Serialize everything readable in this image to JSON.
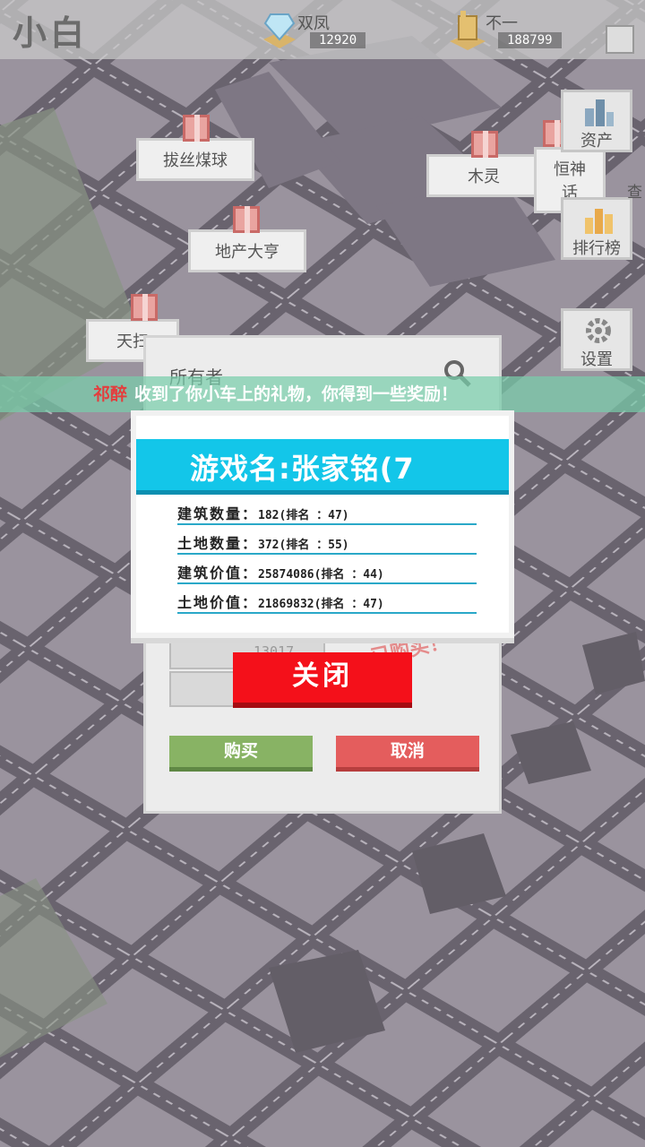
{
  "player": {
    "name": "小白"
  },
  "resources": {
    "gem": {
      "name": "双凤",
      "value": "12920",
      "icon": "diamond-icon"
    },
    "coin": {
      "name": "不一",
      "value": "188799",
      "icon": "coin-stack-icon"
    }
  },
  "map_bubbles": [
    {
      "label": "拔丝煤球"
    },
    {
      "label": "木灵"
    },
    {
      "label": "恒神话"
    },
    {
      "label": "地产大亨"
    },
    {
      "label": "天扫"
    }
  ],
  "side_menu": {
    "assets": "资产",
    "ranking": "排行榜",
    "settings": "设置",
    "peek": "查"
  },
  "owner_dialog": {
    "title": "所有者",
    "coin_value": "13017",
    "buy_label": "购买",
    "cancel_label": "取消",
    "stamp_text": "已购买！"
  },
  "notice": {
    "player": "祁醉",
    "message": "收到了你小车上的礼物，你得到一些奖励！"
  },
  "info_card": {
    "title": "游戏名:张家铭(7",
    "rows": [
      {
        "label": "建筑数量：",
        "value": "182(排名 ：47)"
      },
      {
        "label": "土地数量：",
        "value": "372(排名 ：55)"
      },
      {
        "label": "建筑价值：",
        "value": "25874086(排名 ：44)"
      },
      {
        "label": "土地价值：",
        "value": "21869832(排名 ：47)"
      }
    ],
    "close_label": "关闭"
  },
  "colors": {
    "accent": "#13c6e9",
    "close": "#f4101a",
    "buy": "#88b364",
    "cancel": "#e45d5d",
    "notice_bg": "#78cdaa",
    "notice_name": "#e43d3d"
  }
}
